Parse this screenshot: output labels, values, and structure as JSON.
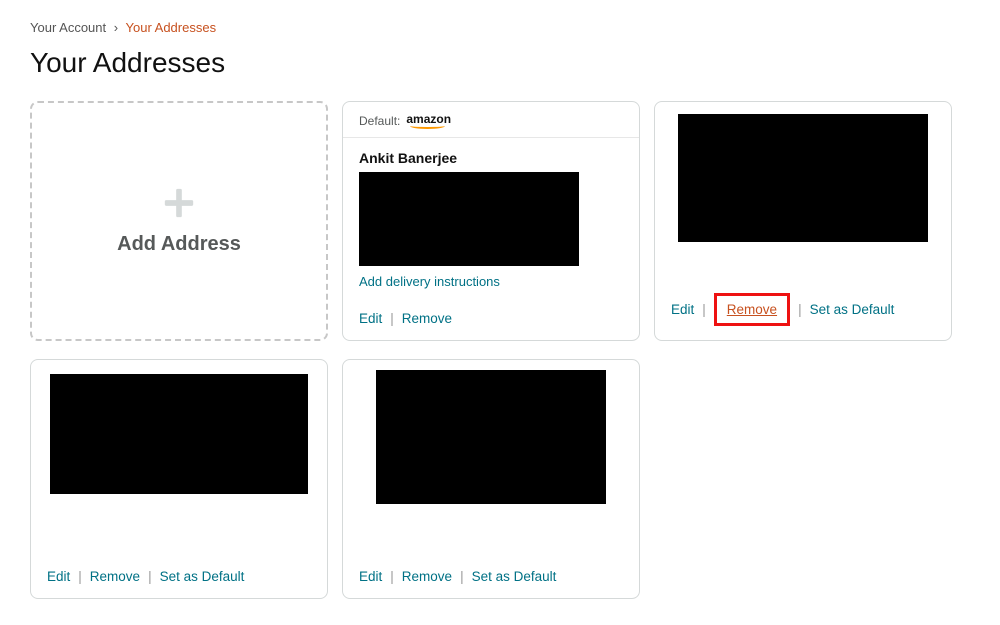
{
  "breadcrumb": {
    "parent": "Your Account",
    "current": "Your Addresses"
  },
  "page_title": "Your Addresses",
  "add_card": {
    "label": "Add Address"
  },
  "cards": {
    "default_label": "Default:",
    "amazon_logo_text": "amazon",
    "recipient_name": "Ankit Banerjee",
    "delivery_instructions": "Add delivery instructions",
    "actions": {
      "edit": "Edit",
      "remove": "Remove",
      "set_default": "Set as Default"
    }
  }
}
